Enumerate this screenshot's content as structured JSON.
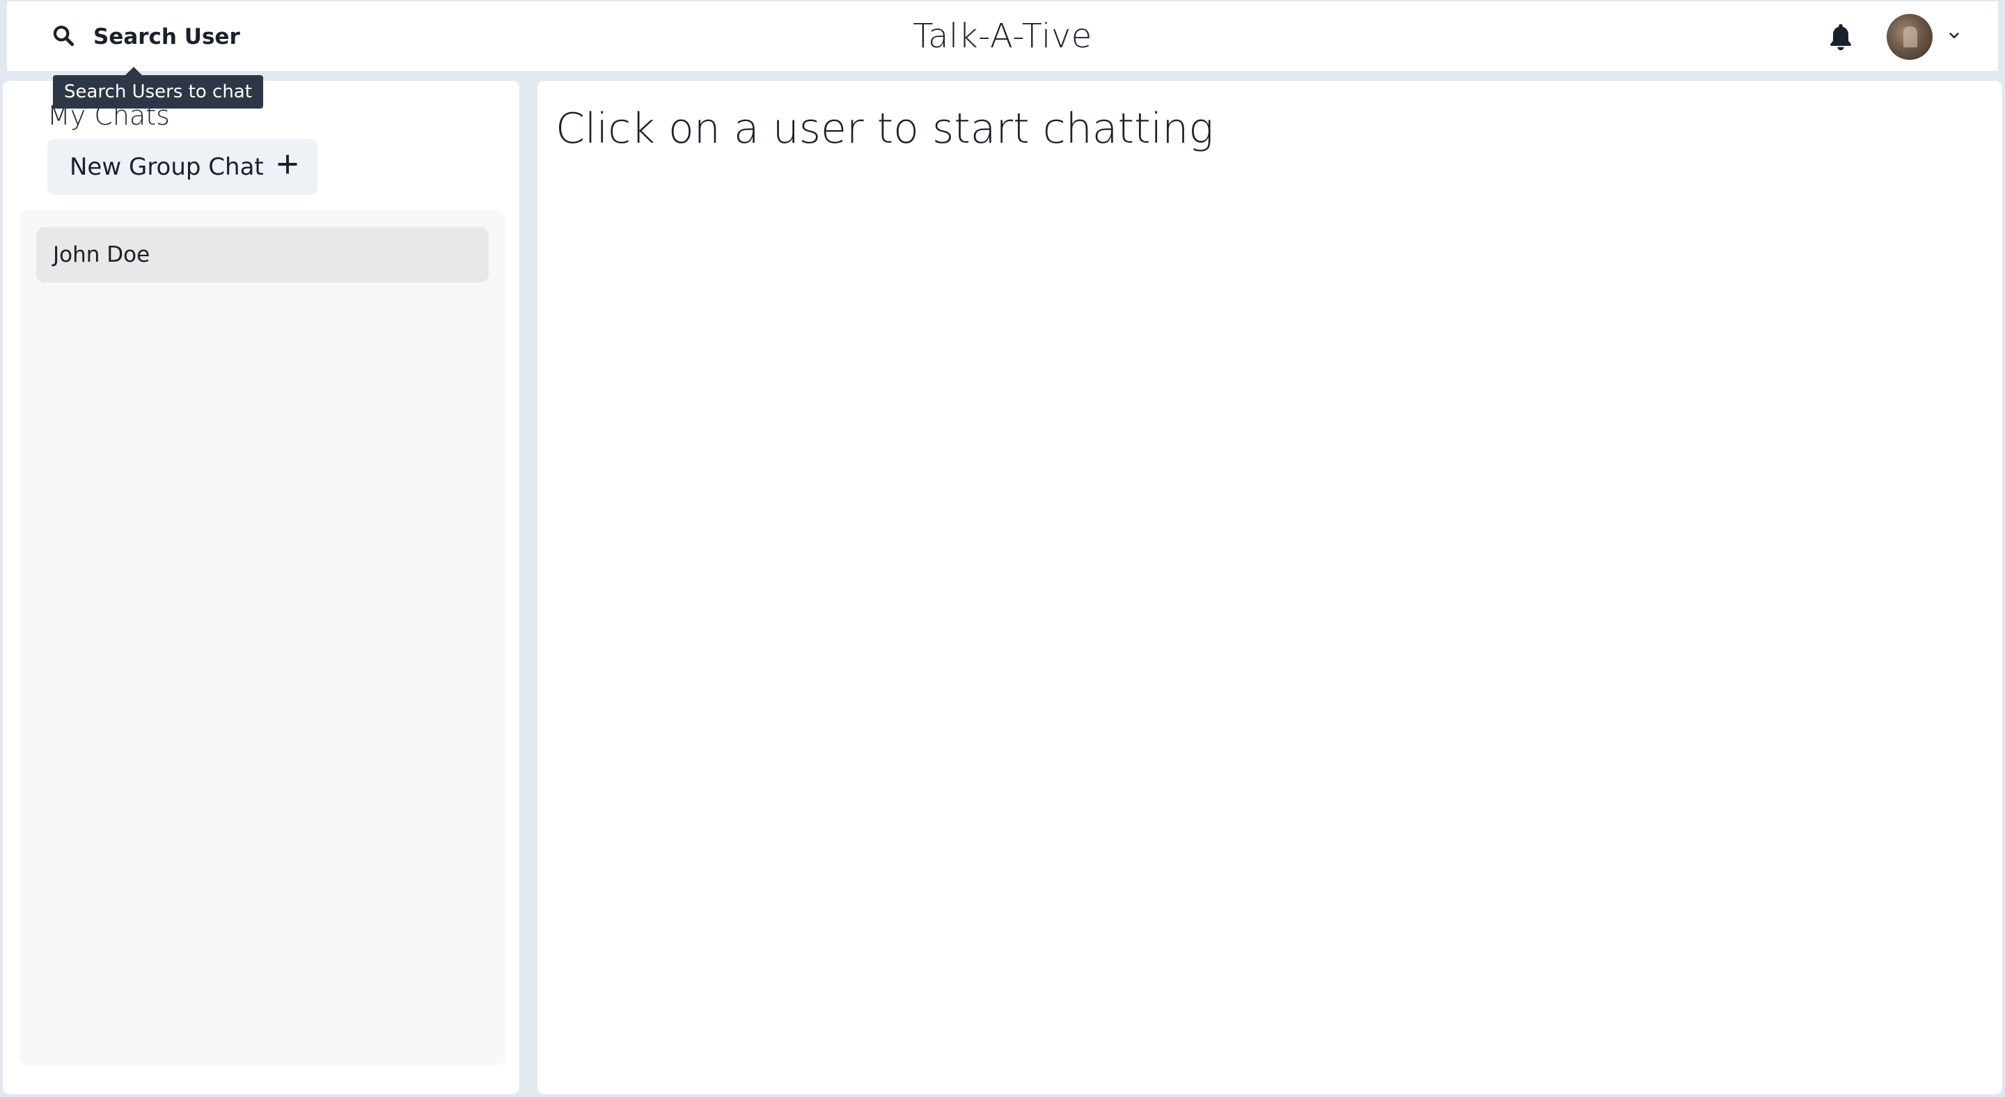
{
  "header": {
    "search_label": "Search User",
    "search_tooltip": "Search Users to chat",
    "app_title": "Talk-A-Tive",
    "notification_icon": "bell-icon",
    "profile_icon": "avatar",
    "menu_icon": "chevron-down-icon"
  },
  "sidebar": {
    "title": "My Chats",
    "new_group_label": "New Group Chat",
    "new_group_icon": "plus-icon",
    "chats": [
      {
        "name": "John Doe"
      }
    ]
  },
  "main": {
    "placeholder": "Click on a user to start chatting"
  },
  "colors": {
    "background": "#e2e8f0",
    "panel": "#ffffff",
    "tooltip": "#2d3748",
    "button": "#edf2f7",
    "chat_list": "#f8f8f8",
    "chat_item": "#e8e8e8"
  }
}
